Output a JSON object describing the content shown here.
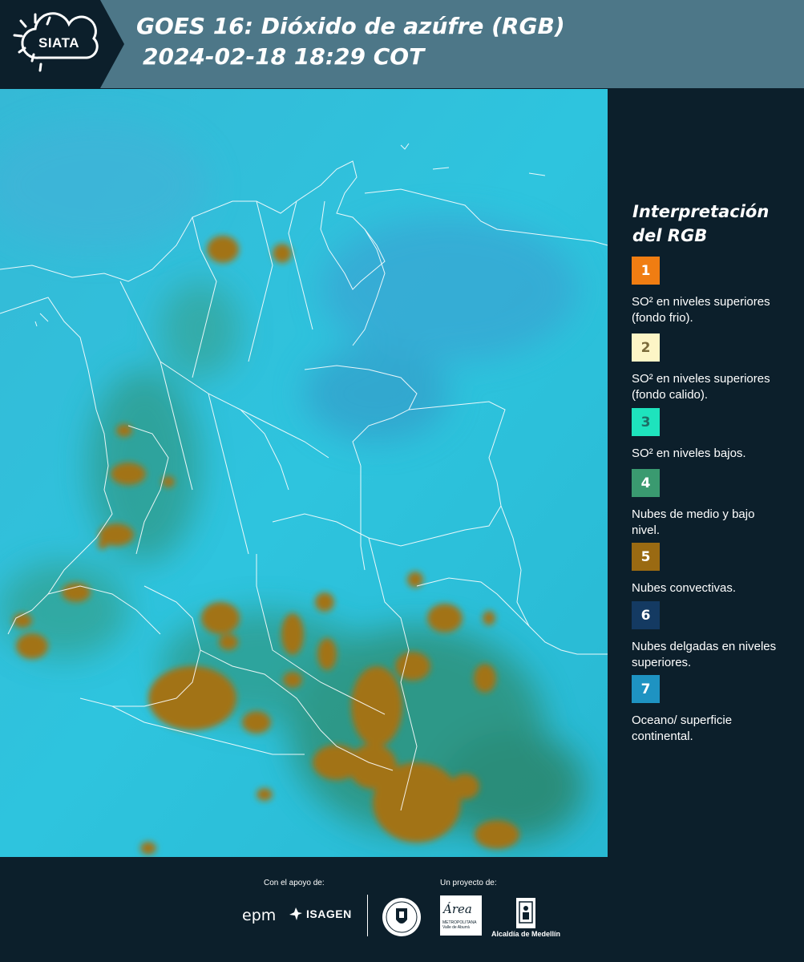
{
  "header": {
    "logo_text": "SIATA",
    "title_line1": "GOES 16: Dióxido de azúfre (RGB)",
    "title_line2": "2024-02-18 18:29 COT"
  },
  "legend": {
    "title": "Interpretación del RGB",
    "items": [
      {
        "number": "1",
        "label": "SO² en niveles superiores (fondo frio).",
        "color": "#f07d12",
        "text_color": "#ffffff"
      },
      {
        "number": "2",
        "label": "SO² en niveles superiores (fondo calido).",
        "color": "#fdf5c6",
        "text_color": "#7a6a3a"
      },
      {
        "number": "3",
        "label": "SO² en niveles bajos.",
        "color": "#1ee3bd",
        "text_color": "#1e6f66"
      },
      {
        "number": "4",
        "label": "Nubes de medio y bajo nivel.",
        "color": "#3a9a70",
        "text_color": "#ffffff"
      },
      {
        "number": "5",
        "label": "Nubes convectivas.",
        "color": "#9a6a12",
        "text_color": "#ffffff"
      },
      {
        "number": "6",
        "label": "Nubes delgadas en niveles superiores.",
        "color": "#143a62",
        "text_color": "#ffffff"
      },
      {
        "number": "7",
        "label": "Oceano/ superficie continental.",
        "color": "#1e93c2",
        "text_color": "#ffffff"
      }
    ]
  },
  "footer": {
    "support_label": "Con el apoyo de:",
    "project_label": "Un proyecto de:",
    "epm": "epm",
    "isagen": "ISAGEN",
    "area_name": "Área",
    "area_sub1": "METROPOLITANA",
    "area_sub2": "Valle de Aburrá",
    "alcaldia": "Alcaldía de Medellín"
  }
}
